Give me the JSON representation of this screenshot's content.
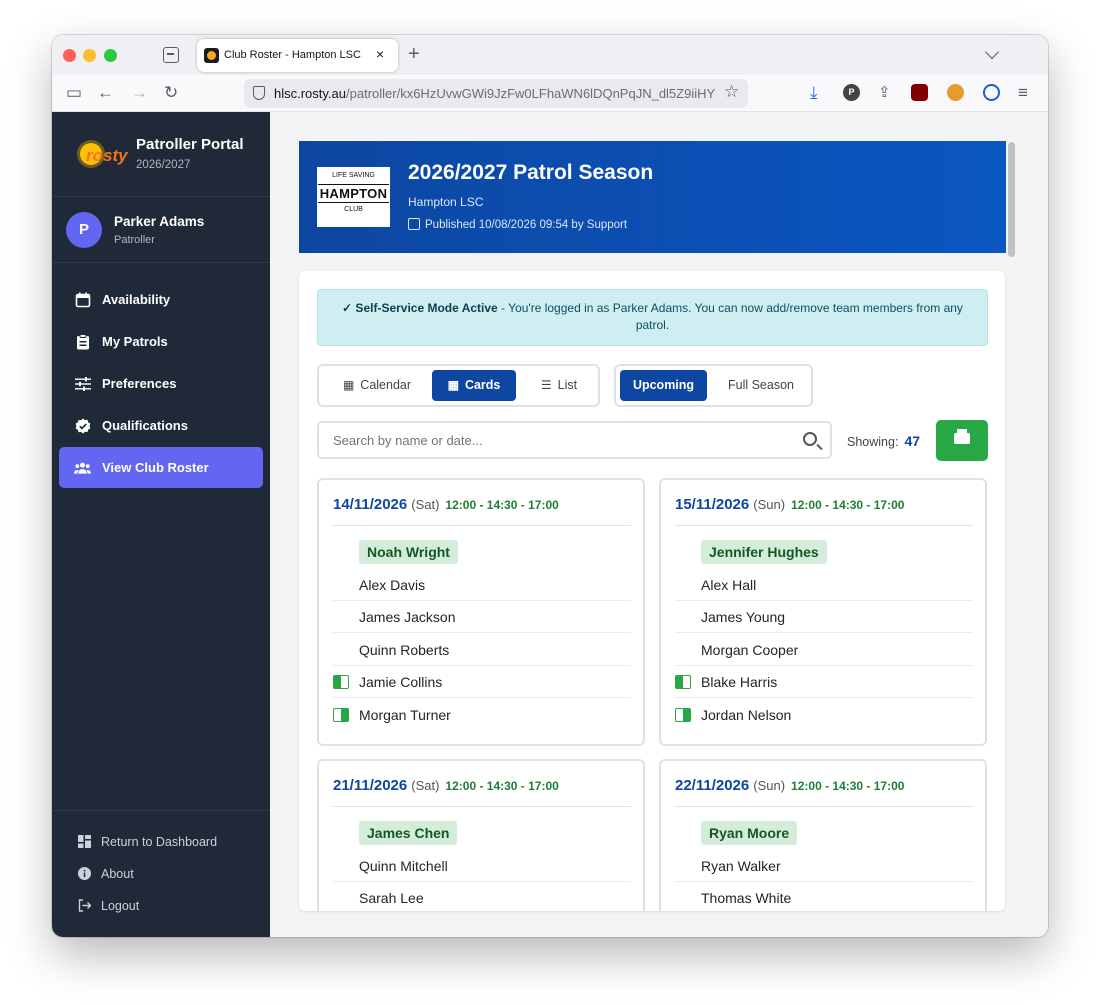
{
  "browser": {
    "tab_title": "Club Roster - Hampton LSC",
    "tab_close": "×",
    "new_tab": "+",
    "url_domain": "hlsc.rosty.au",
    "url_path": "/patroller/kx6HzUvwGWi9JzFw0LFhaWN6lDQnPqJN_dl5Z9iiHY",
    "ext_p_label": "P"
  },
  "sidebar": {
    "logo_word": "rosty",
    "brand_title": "Patroller Portal",
    "brand_season": "2026/2027",
    "user": {
      "initial": "P",
      "name": "Parker Adams",
      "role": "Patroller"
    },
    "items": [
      {
        "label": "Availability",
        "icon": "calendar-icon"
      },
      {
        "label": "My Patrols",
        "icon": "clipboard-icon"
      },
      {
        "label": "Preferences",
        "icon": "sliders-icon"
      },
      {
        "label": "Qualifications",
        "icon": "badge-check-icon"
      },
      {
        "label": "View Club Roster",
        "icon": "users-icon",
        "active": true
      }
    ],
    "footer": [
      {
        "label": "Return to Dashboard",
        "icon": "dashboard-icon"
      },
      {
        "label": "About",
        "icon": "info-icon"
      },
      {
        "label": "Logout",
        "icon": "logout-icon"
      }
    ]
  },
  "header": {
    "title": "2026/2027 Patrol Season",
    "club": "Hampton LSC",
    "published": "Published 10/08/2026 09:54 by Support",
    "logo": {
      "top": "LIFE SAVING",
      "name": "HAMPTON",
      "bottom": "CLUB"
    }
  },
  "alert": {
    "strong": "✓ Self-Service Mode Active",
    "text": " - You're logged in as Parker Adams. You can now add/remove team members from any patrol."
  },
  "view_modes": [
    {
      "label": "Calendar"
    },
    {
      "label": "Cards",
      "active": true
    },
    {
      "label": "List"
    }
  ],
  "range_modes": [
    {
      "label": "Upcoming",
      "active": true
    },
    {
      "label": "Full Season"
    }
  ],
  "search": {
    "placeholder": "Search by name or date..."
  },
  "showing": {
    "label": "Showing:",
    "count": "47"
  },
  "accent": "#0d47a1",
  "cards": [
    {
      "date": "14/11/2026",
      "day": "(Sat)",
      "time": "12:00 - 14:30 - 17:00",
      "leader": "Noah Wright",
      "members": [
        {
          "name": "Alex Davis"
        },
        {
          "name": "James Jackson"
        },
        {
          "name": "Quinn Roberts"
        },
        {
          "name": "Jamie Collins",
          "flag": "left"
        },
        {
          "name": "Morgan Turner",
          "flag": "right"
        }
      ]
    },
    {
      "date": "15/11/2026",
      "day": "(Sun)",
      "time": "12:00 - 14:30 - 17:00",
      "leader": "Jennifer Hughes",
      "members": [
        {
          "name": "Alex Hall"
        },
        {
          "name": "James Young"
        },
        {
          "name": "Morgan Cooper"
        },
        {
          "name": "Blake Harris",
          "flag": "left"
        },
        {
          "name": "Jordan Nelson",
          "flag": "right"
        }
      ]
    },
    {
      "date": "21/11/2026",
      "day": "(Sat)",
      "time": "12:00 - 14:30 - 17:00",
      "leader": "James Chen",
      "members": [
        {
          "name": "Quinn Mitchell"
        },
        {
          "name": "Sarah Lee"
        }
      ]
    },
    {
      "date": "22/11/2026",
      "day": "(Sun)",
      "time": "12:00 - 14:30 - 17:00",
      "leader": "Ryan Moore",
      "members": [
        {
          "name": "Ryan Walker"
        },
        {
          "name": "Thomas White"
        }
      ]
    }
  ]
}
